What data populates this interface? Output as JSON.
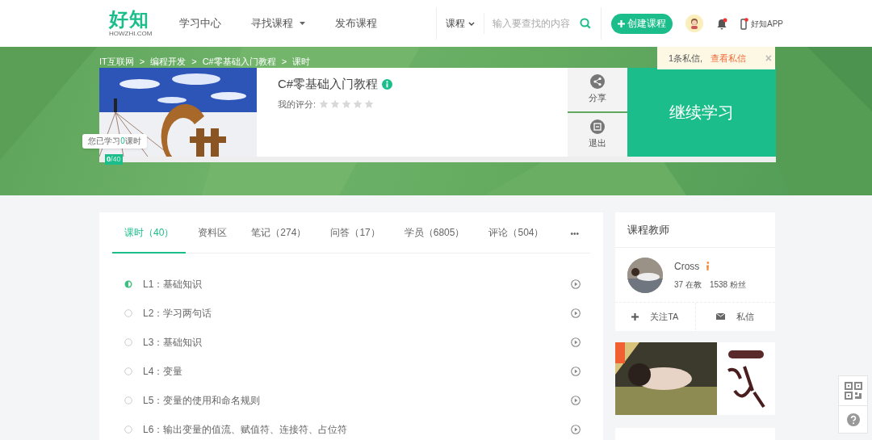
{
  "header": {
    "logo": {
      "name": "好知",
      "subtitle": "HOWZHI.COM"
    },
    "nav": [
      {
        "label": "学习中心",
        "dropdown": false
      },
      {
        "label": "寻找课程",
        "dropdown": true
      },
      {
        "label": "发布课程",
        "dropdown": false
      }
    ],
    "search": {
      "scope": "课程",
      "placeholder": "输入要查找的内容"
    },
    "create_button": "创建课程",
    "app_label": "好知APP"
  },
  "notice": {
    "text": "1条私信,",
    "link": "查看私信",
    "close": "×"
  },
  "breadcrumb": {
    "separator": ">",
    "items": [
      "IT互联网",
      "编程开发",
      "C#零基础入门教程",
      "课时"
    ]
  },
  "course": {
    "title": "C#零基础入门教程",
    "rating_label": "我的评分:",
    "stars": 0,
    "actions": [
      {
        "label": "分享",
        "kind": "share"
      },
      {
        "label": "退出",
        "kind": "quit"
      }
    ],
    "continue_button": "继续学习",
    "progress": {
      "done": "0",
      "total": "/40",
      "level": 0
    },
    "tooltip": {
      "prefix": "您已学习",
      "count": "0",
      "suffix": "课时"
    }
  },
  "tabs": [
    {
      "label": "课时（40）",
      "selected": true
    },
    {
      "label": "资料区",
      "selected": false
    },
    {
      "label": "笔记（274）",
      "selected": false
    },
    {
      "label": "问答（17）",
      "selected": false
    },
    {
      "label": "学员（6805）",
      "selected": false
    },
    {
      "label": "评论（504）",
      "selected": false
    }
  ],
  "tabs_more": "•••",
  "lessons": [
    {
      "label": "L1：基础知识",
      "kind": "started"
    },
    {
      "label": "L2：学习两句话",
      "kind": "unstarted"
    },
    {
      "label": "L3：基础知识",
      "kind": "unstarted"
    },
    {
      "label": "L4：变量",
      "kind": "unstarted"
    },
    {
      "label": "L5：变量的使用和命名规则",
      "kind": "unstarted"
    },
    {
      "label": "L6：输出变量的值流、赋值符、连接符、占位符",
      "kind": "unstarted"
    }
  ],
  "teacher": {
    "heading": "课程教师",
    "name": "Cross",
    "stats": [
      "37 在教",
      "1538 粉丝"
    ],
    "actions": [
      {
        "label": "关注TA",
        "kind": "follow"
      },
      {
        "label": "私信",
        "kind": "message"
      }
    ]
  }
}
